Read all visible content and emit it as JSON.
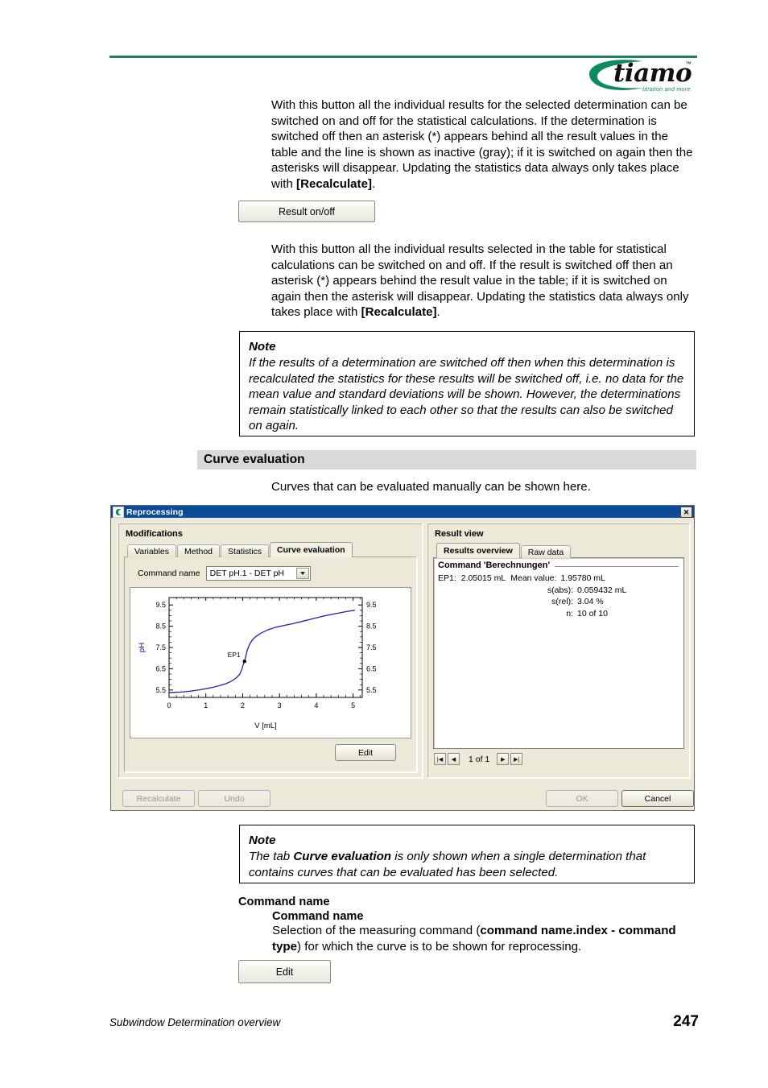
{
  "header": {
    "logo_word": "tiamo",
    "logo_tm": "™",
    "logo_tagline": "titration and more",
    "rule_color": "#1f8263"
  },
  "intro_paragraph_1": "With this button all the individual results for the selected determination can be switched on and off for the statistical calculations. If the determination is switched off then an asterisk (*) appears behind all the result values in the table and the line is shown as inactive (gray); if it is switched on again then the asterisks will disappear. Updating the statistics data always only takes place with ",
  "intro_paragraph_1_bold": "[Recalculate]",
  "intro_paragraph_1_end": ".",
  "result_onoff_button": "Result on/off",
  "intro_paragraph_2": "With this button all the individual results selected in the table for statistical calculations can be switched on and off. If the result is switched off then an asterisk (*) appears behind the result value in the table; if it is switched on again then the asterisk will disappear. Updating the statistics data always only takes place with ",
  "intro_paragraph_2_bold": "[Recalculate]",
  "intro_paragraph_2_end": ".",
  "note_top": {
    "title": "Note",
    "body": "If the results of a determination are switched off then when this determination is recalculated the statistics for these results will be switched off, i.e. no data for the mean value and standard deviations will be shown. However, the determinations remain statistically linked to each other so that the results can also be switched on again."
  },
  "section": {
    "heading": "Curve evaluation",
    "lead": "Curves that can be evaluated manually can be shown here."
  },
  "dialog": {
    "title": "Reprocessing",
    "close_label": "✕",
    "left_group_title": "Modifications",
    "right_group_title": "Result view",
    "tabs": [
      {
        "label": "Variables",
        "active": false
      },
      {
        "label": "Method",
        "active": false
      },
      {
        "label": "Statistics",
        "active": false
      },
      {
        "label": "Curve evaluation",
        "active": true
      }
    ],
    "command_name_label": "Command name",
    "command_name_value": "DET pH.1 - DET pH",
    "edit_button": "Edit",
    "result_tabs": [
      {
        "label": "Results overview",
        "active": true
      },
      {
        "label": "Raw data",
        "active": false
      }
    ],
    "result_view": {
      "command_title": "Command 'Berechnungen'",
      "ep_label": "EP1:",
      "ep_value": "2.05015 mL",
      "rows": [
        {
          "key": "Mean value:",
          "value": "1.95780 mL"
        },
        {
          "key": "s(abs):",
          "value": "0.059432 mL"
        },
        {
          "key": "s(rel):",
          "value": "3.04 %"
        },
        {
          "key": "n:",
          "value": "10 of 10"
        }
      ]
    },
    "nav": {
      "first": "|◀",
      "prev": "◀",
      "label": "1 of 1",
      "next": "▶",
      "last": "▶|"
    },
    "recalculate_button": "Recalculate",
    "undo_button": "Undo",
    "ok_button": "OK",
    "cancel_button": "Cancel"
  },
  "chart_data": {
    "type": "line",
    "title": "",
    "xlabel": "V [mL]",
    "ylabel": "pH",
    "xlim": [
      0,
      5.25
    ],
    "ylim": [
      5.15,
      9.85
    ],
    "xticks": [
      0,
      1,
      2,
      3,
      4,
      5
    ],
    "yticks": [
      5.5,
      6.5,
      7.5,
      8.5,
      9.5
    ],
    "ytick_labels_right": [
      5.5,
      6.5,
      7.5,
      8.5,
      9.5
    ],
    "grid": false,
    "legend": "none",
    "curve_color": "#2222aa",
    "axis_label_color": "#0000cc",
    "annotations": [
      {
        "label": "EP1",
        "x": 2.05,
        "y": 6.85,
        "marker": "dot"
      }
    ],
    "series": [
      {
        "name": "pH titration curve",
        "x": [
          0.0,
          0.15,
          0.3,
          0.45,
          0.6,
          0.8,
          1.0,
          1.2,
          1.4,
          1.55,
          1.7,
          1.82,
          1.92,
          1.98,
          2.02,
          2.05,
          2.08,
          2.12,
          2.18,
          2.26,
          2.36,
          2.5,
          2.7,
          2.9,
          3.1,
          3.35,
          3.6,
          3.9,
          4.2,
          4.55,
          4.85,
          5.05
        ],
        "y": [
          5.38,
          5.39,
          5.4,
          5.42,
          5.45,
          5.5,
          5.56,
          5.63,
          5.72,
          5.8,
          5.92,
          6.06,
          6.24,
          6.48,
          6.72,
          6.85,
          7.05,
          7.35,
          7.62,
          7.85,
          8.02,
          8.18,
          8.34,
          8.45,
          8.53,
          8.62,
          8.72,
          8.85,
          8.98,
          9.1,
          9.2,
          9.25
        ]
      }
    ]
  },
  "note_bottom": {
    "title": "Note",
    "text_a": "The tab ",
    "text_bold": "Curve evaluation",
    "text_b": " is only shown when a single determination that contains curves that can be evaluated has been selected."
  },
  "command_section": {
    "heading": "Command name",
    "subheading": "Command name",
    "desc_a": "Selection of the measuring command (",
    "desc_bold": "command name.index - command type",
    "desc_b": ") for which the curve is to be shown for reprocessing."
  },
  "edit_button_bottom": "Edit",
  "footer": {
    "left": "Subwindow Determination overview",
    "page": "247"
  }
}
